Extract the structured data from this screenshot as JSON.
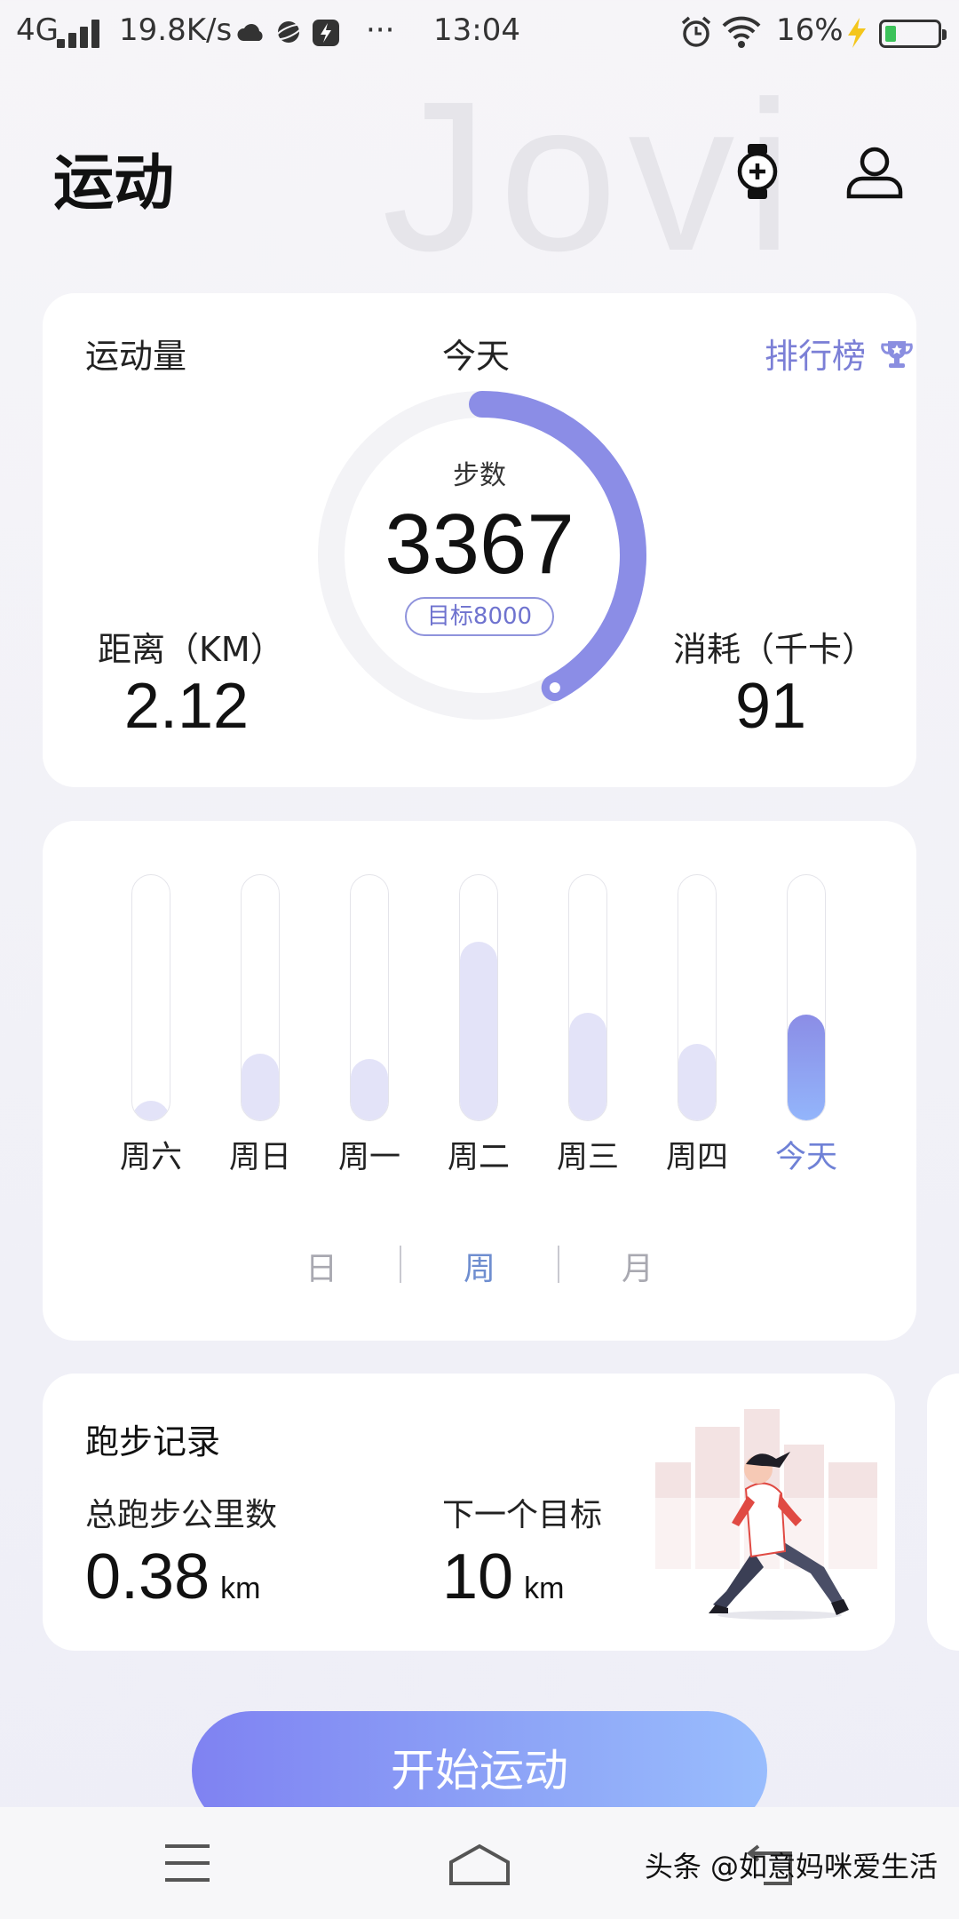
{
  "status_bar": {
    "network": "4G",
    "speed": "19.8K/s",
    "time": "13:04",
    "battery": "16%",
    "dots": "···"
  },
  "header": {
    "title": "运动",
    "watermark": "Jovi"
  },
  "summary_card": {
    "label": "运动量",
    "period": "今天",
    "ranking": "排行榜",
    "steps_label": "步数",
    "steps": "3367",
    "goal": "目标8000",
    "goal_progress": 0.42,
    "distance_label": "距离（KM）",
    "distance": "2.12",
    "calories_label": "消耗（千卡）",
    "calories": "91"
  },
  "weekly_card": {
    "days": [
      {
        "label": "周六",
        "level": 0.08
      },
      {
        "label": "周日",
        "level": 0.27
      },
      {
        "label": "周一",
        "level": 0.25
      },
      {
        "label": "周二",
        "level": 0.73
      },
      {
        "label": "周三",
        "level": 0.44
      },
      {
        "label": "周四",
        "level": 0.31
      },
      {
        "label": "今天",
        "level": 0.43
      }
    ],
    "segments": [
      "日",
      "周",
      "月"
    ],
    "active_segment": "周"
  },
  "run_card": {
    "title": "跑步记录",
    "total_label": "总跑步公里数",
    "total_value": "0.38",
    "total_unit": "km",
    "next_label": "下一个目标",
    "next_value": "10",
    "next_unit": "km"
  },
  "start_button": "开始运动",
  "credit": "头条 @如意妈咪爱生活",
  "colors": {
    "accent": "#8b8de6",
    "bar_inactive": "#e3e3f8",
    "active_text": "#6f81d6"
  }
}
